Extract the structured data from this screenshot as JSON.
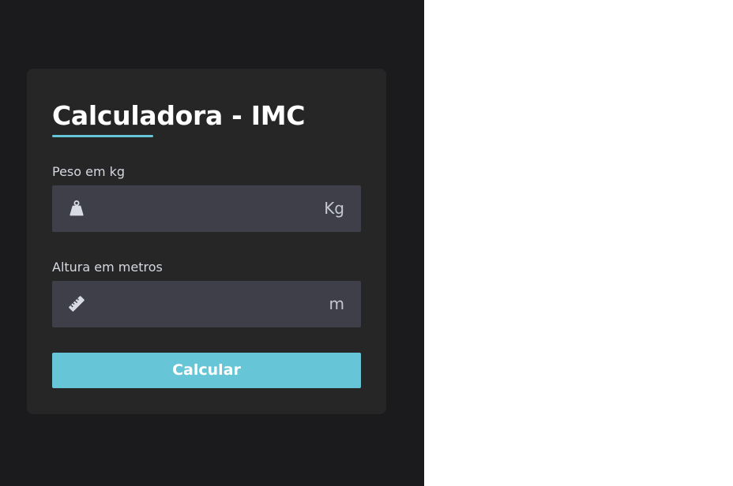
{
  "card": {
    "title": "Calculadora - IMC"
  },
  "peso": {
    "label": "Peso em kg",
    "value": "",
    "unit": "Kg",
    "icon": "weight-icon"
  },
  "altura": {
    "label": "Altura em metros",
    "value": "",
    "unit": "m",
    "icon": "ruler-icon"
  },
  "button": {
    "label": "Calcular"
  },
  "colors": {
    "background_dark": "#1b1b1d",
    "card": "#262627",
    "input": "#3e3f48",
    "accent": "#66c5d6",
    "text": "#ffffff",
    "label": "#d6d8e0"
  }
}
